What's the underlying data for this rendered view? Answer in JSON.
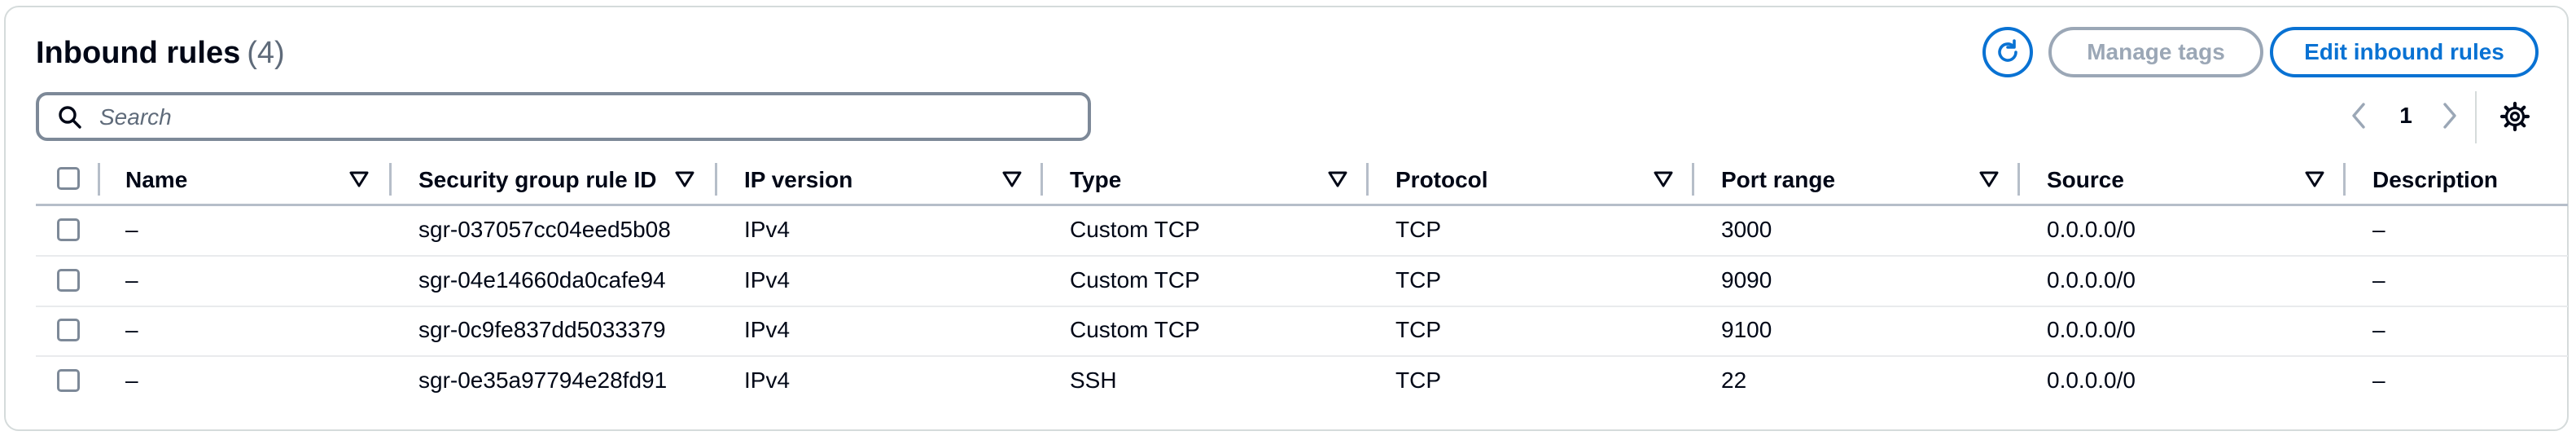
{
  "header": {
    "title": "Inbound rules",
    "count": "(4)",
    "manage_tags_label": "Manage tags",
    "edit_label": "Edit inbound rules"
  },
  "search": {
    "placeholder": "Search",
    "value": ""
  },
  "pagination": {
    "current_page": "1"
  },
  "table": {
    "columns": [
      "Name",
      "Security group rule ID",
      "IP version",
      "Type",
      "Protocol",
      "Port range",
      "Source",
      "Description"
    ],
    "rows": [
      {
        "name": "–",
        "rule_id": "sgr-037057cc04eed5b08",
        "ip_version": "IPv4",
        "type": "Custom TCP",
        "protocol": "TCP",
        "port_range": "3000",
        "source": "0.0.0.0/0",
        "description": "–"
      },
      {
        "name": "–",
        "rule_id": "sgr-04e14660da0cafe94",
        "ip_version": "IPv4",
        "type": "Custom TCP",
        "protocol": "TCP",
        "port_range": "9090",
        "source": "0.0.0.0/0",
        "description": "–"
      },
      {
        "name": "–",
        "rule_id": "sgr-0c9fe837dd5033379",
        "ip_version": "IPv4",
        "type": "Custom TCP",
        "protocol": "TCP",
        "port_range": "9100",
        "source": "0.0.0.0/0",
        "description": "–"
      },
      {
        "name": "–",
        "rule_id": "sgr-0e35a97794e28fd91",
        "ip_version": "IPv4",
        "type": "SSH",
        "protocol": "TCP",
        "port_range": "22",
        "source": "0.0.0.0/0",
        "description": "–"
      }
    ]
  },
  "icons": {
    "refresh": "refresh-icon",
    "search": "search-icon",
    "prev": "chevron-left-icon",
    "next": "chevron-right-icon",
    "settings": "gear-icon",
    "sort": "caret-down-outline-icon"
  },
  "colors": {
    "accent": "#0972d3",
    "disabled": "#9ba7b6",
    "text": "#000716",
    "muted": "#5f6b7a",
    "divider": "#b6bec9"
  }
}
